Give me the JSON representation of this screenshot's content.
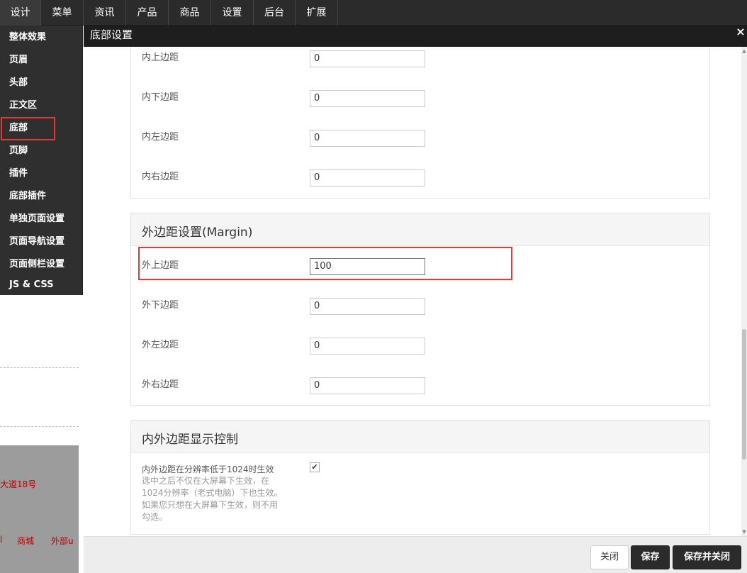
{
  "topmenu": [
    "设计",
    "菜单",
    "资讯",
    "产品",
    "商品",
    "设置",
    "后台",
    "扩展"
  ],
  "leftmenu": [
    "整体效果",
    "页眉",
    "头部",
    "正文区",
    "底部",
    "页脚",
    "插件",
    "底部插件",
    "单独页面设置",
    "页面导航设置",
    "页面侧栏设置",
    "JS & CSS"
  ],
  "background": {
    "address_fragment": "大道18号",
    "link1": "l",
    "link2": "商城",
    "link3": "外部u"
  },
  "modal": {
    "title": "底部设置",
    "close_icon": "×",
    "padding_section": {
      "rows": [
        {
          "label": "内上边距",
          "value": "0"
        },
        {
          "label": "内下边距",
          "value": "0"
        },
        {
          "label": "内左边距",
          "value": "0"
        },
        {
          "label": "内右边距",
          "value": "0"
        }
      ]
    },
    "margin_section": {
      "title": "外边距设置(Margin)",
      "rows": [
        {
          "label": "外上边距",
          "value": "100"
        },
        {
          "label": "外下边距",
          "value": "0"
        },
        {
          "label": "外左边距",
          "value": "0"
        },
        {
          "label": "外右边距",
          "value": "0"
        }
      ]
    },
    "display_section": {
      "title": "内外边距显示控制",
      "option_label": "内外边距在分辨率低于1024时生效",
      "option_checked": true,
      "help_lines": [
        "选中之后不仅在大屏幕下生效，在",
        "1024分辨率（老式电脑）下也生效。",
        "如果您只想在大屏幕下生效，则不用",
        "勾选。"
      ]
    },
    "buttons": {
      "close": "关闭",
      "save": "保存",
      "save_close": "保存并关闭"
    }
  },
  "colors": {
    "highlight": "#e53935",
    "menubar": "#2b2b2b"
  }
}
